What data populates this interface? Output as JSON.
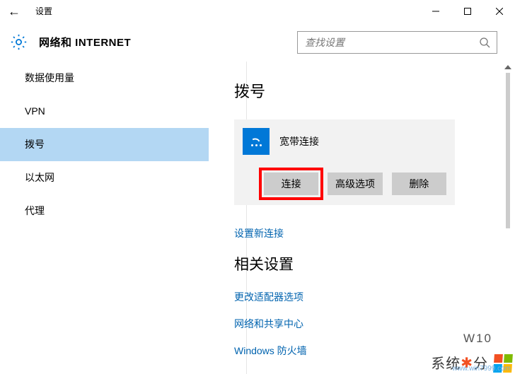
{
  "titlebar": {
    "app_name": "设置"
  },
  "header": {
    "title": "网络和 INTERNET"
  },
  "search": {
    "placeholder": "查找设置"
  },
  "sidebar": {
    "items": [
      {
        "label": "数据使用量"
      },
      {
        "label": "VPN"
      },
      {
        "label": "拨号"
      },
      {
        "label": "以太网"
      },
      {
        "label": "代理"
      }
    ],
    "selected": 2
  },
  "main": {
    "section_title": "拨号",
    "connection": {
      "name": "宽带连接",
      "buttons": {
        "connect": "连接",
        "advanced": "高级选项",
        "delete": "删除"
      }
    },
    "new_link": "设置新连接",
    "related": {
      "title": "相关设置",
      "links": [
        "更改适配器选项",
        "网络和共享中心",
        "Windows 防火墙"
      ]
    }
  },
  "watermark": {
    "brand_a": "系统",
    "brand_b": "分",
    "url": "www.win7999.com",
    "wif": "W10"
  }
}
